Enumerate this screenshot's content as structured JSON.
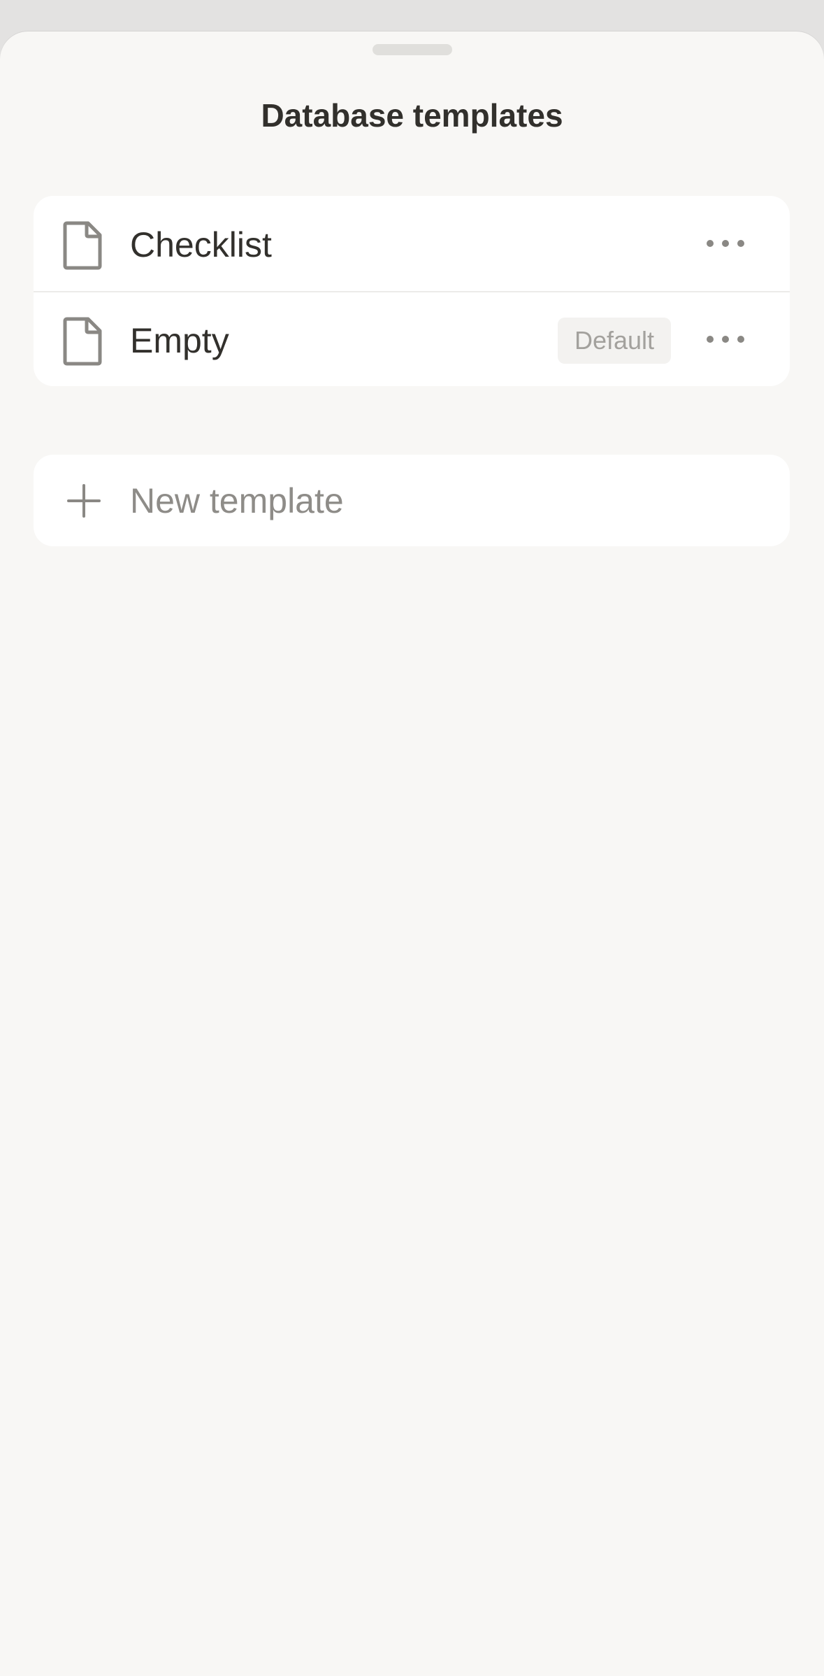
{
  "sheet": {
    "title": "Database templates"
  },
  "templates": [
    {
      "label": "Checklist",
      "badge": "",
      "more_icon": "ellipsis-icon",
      "icon": "document-icon"
    },
    {
      "label": "Empty",
      "badge": "Default",
      "more_icon": "ellipsis-icon",
      "icon": "document-icon"
    }
  ],
  "new_template": {
    "label": "New template",
    "icon": "plus-icon"
  },
  "colors": {
    "background": "#f8f7f5",
    "card": "#ffffff",
    "text_primary": "#32302c",
    "text_secondary": "#8e8c88",
    "icon": "#8a8884"
  }
}
